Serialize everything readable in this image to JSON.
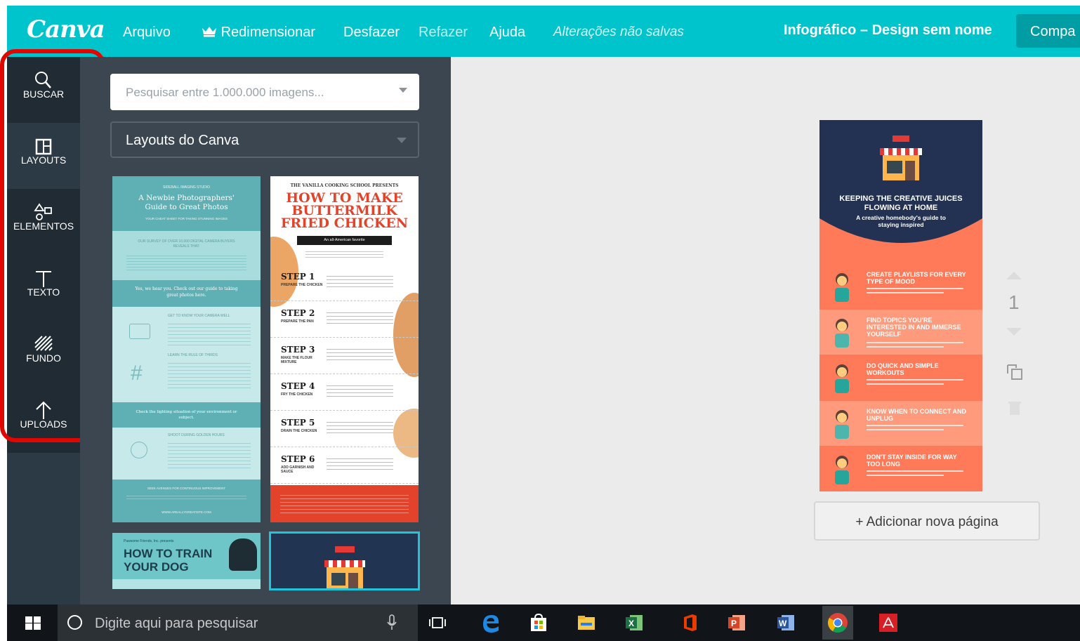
{
  "topbar": {
    "logo": "Canva",
    "menu": [
      "Arquivo",
      "Redimensionar",
      "Desfazer",
      "Refazer",
      "Ajuda"
    ],
    "status": "Alterações não salvas",
    "title": "Infográfico – Design sem nome",
    "share": "Compa"
  },
  "sidenav": {
    "items": [
      {
        "label": "BUSCAR",
        "icon": "search-icon"
      },
      {
        "label": "LAYOUTS",
        "icon": "layouts-icon"
      },
      {
        "label": "ELEMENTOS",
        "icon": "shapes-icon"
      },
      {
        "label": "TEXTO",
        "icon": "text-icon"
      },
      {
        "label": "FUNDO",
        "icon": "background-icon"
      },
      {
        "label": "UPLOADS",
        "icon": "upload-icon"
      }
    ],
    "active": "LAYOUTS"
  },
  "panel": {
    "search_placeholder": "Pesquisar entre 1.000.000 imagens...",
    "source": "Layouts do Canva",
    "thumb_photo": {
      "studio": "SIDEBALL IMAGING STUDIO",
      "title": "A Newbie Photographers' Guide to Great Photos",
      "subtitle": "YOUR CHEAT SHEET FOR TAKING STUNNING IMAGES",
      "survey": "OUR SURVEY OF OVER 10,000 DIGITAL CAMERA BUYERS REVEALS THAT:",
      "quote": "Yes, we hear you. Check out our guide to taking great photos here.",
      "tip1": "GET TO KNOW YOUR CAMERA WELL",
      "tip2": "LEARN THE RULE OF THIRDS",
      "banner": "Check the lighting situation of your environment or subject.",
      "tip3": "SHOOT DURING GOLDEN HOURS",
      "seek": "SEEK AVENUES FOR CONTINUOUS IMPROVEMENT",
      "site": "WWW.AREALLYGREATSITE.COM"
    },
    "thumb_chicken": {
      "presents": "THE VANILLA COOKING SCHOOL PRESENTS",
      "title": "HOW TO MAKE BUTTERMILK FRIED CHICKEN",
      "tag": "An all-American favorite",
      "steps": [
        {
          "num": "STEP 1",
          "label": "PREPARE THE CHICKEN"
        },
        {
          "num": "STEP 2",
          "label": "PREPARE THE PAN"
        },
        {
          "num": "STEP 3",
          "label": "MAKE THE FLOUR MIXTURE"
        },
        {
          "num": "STEP 4",
          "label": "FRY THE CHICKEN"
        },
        {
          "num": "STEP 5",
          "label": "DRAIN THE CHICKEN"
        },
        {
          "num": "STEP 6",
          "label": "ADD GARNISH AND SAUCE"
        }
      ]
    },
    "thumb_dog": {
      "presents": "Pawsome Friends, Inc. presents",
      "title": "HOW TO TRAIN YOUR DOG"
    }
  },
  "canvas": {
    "infographic": {
      "title": "KEEPING THE CREATIVE JUICES FLOWING AT HOME",
      "subtitle": "A creative homebody's guide to staying inspired",
      "rows": [
        {
          "title": "CREATE PLAYLISTS FOR EVERY TYPE OF MOOD",
          "color": "#ff7a59",
          "icon": "phone-icon"
        },
        {
          "title": "FIND TOPICS YOU'RE INTERESTED IN AND IMMERSE YOURSELF",
          "color": "#ff9a7c",
          "icon": "guitar-icon"
        },
        {
          "title": "DO QUICK AND SIMPLE WORKOUTS",
          "color": "#ff7a59",
          "icon": "woman-icon"
        },
        {
          "title": "KNOW WHEN TO CONNECT AND UNPLUG",
          "color": "#ff9a7c",
          "icon": "laptop-person-icon"
        },
        {
          "title": "DON'T STAY INSIDE FOR WAY TOO LONG",
          "color": "#ff7a59",
          "icon": "hat-person-icon"
        }
      ]
    },
    "page_number": "1",
    "add_page": "+ Adicionar nova página"
  },
  "taskbar": {
    "search_placeholder": "Digite aqui para pesquisar",
    "apps": [
      "edge-icon",
      "store-icon",
      "file-explorer-icon",
      "excel-icon",
      "office-icon",
      "powerpoint-icon",
      "word-icon",
      "chrome-icon",
      "acrobat-icon"
    ]
  },
  "colors": {
    "teal": "#00c4cc",
    "nav": "#2b3a45",
    "panel": "#3b4650",
    "highlight": "#e10600",
    "coral": "#ff7a59",
    "navy": "#213451"
  }
}
